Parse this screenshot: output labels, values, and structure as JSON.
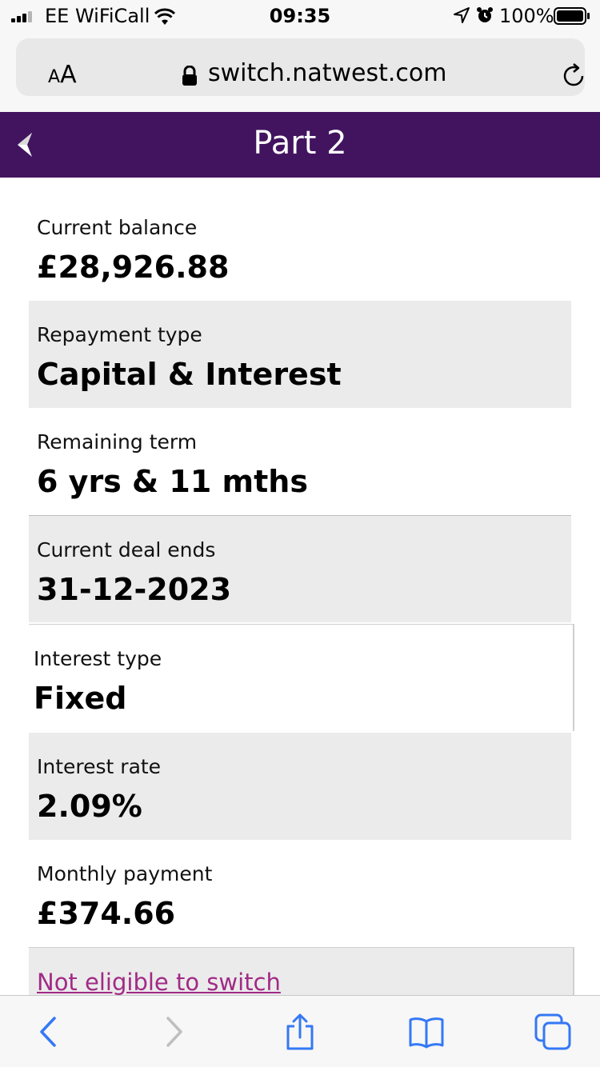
{
  "status_bar": {
    "carrier": "EE WiFiCall",
    "time": "09:35",
    "battery_percent": "100%",
    "icons": [
      "signal-icon",
      "wifi-icon",
      "location-arrow-icon",
      "alarm-icon",
      "battery-icon"
    ]
  },
  "browser": {
    "text_size_label_small": "A",
    "text_size_label_large": "A",
    "url": "switch.natwest.com",
    "icons": [
      "lock-icon",
      "reload-icon"
    ]
  },
  "header": {
    "title": "Part 2",
    "background": "#42145f",
    "icons": [
      "back-chevron-icon"
    ]
  },
  "details": [
    {
      "label": "Current balance",
      "value": "£28,926.88"
    },
    {
      "label": "Repayment type",
      "value": "Capital & Interest"
    },
    {
      "label": "Remaining term",
      "value": "6 yrs & 11 mths"
    },
    {
      "label": "Current deal ends",
      "value": "31-12-2023"
    },
    {
      "label": "Interest type",
      "value": "Fixed"
    },
    {
      "label": "Interest rate",
      "value": "2.09%"
    },
    {
      "label": "Monthly payment",
      "value": "£374.66"
    }
  ],
  "eligibility_link": {
    "label": "Not eligible to switch",
    "color": "#a12a86"
  },
  "toolbar": {
    "icons": [
      "back-arrow-icon",
      "forward-arrow-icon",
      "share-icon",
      "bookmarks-icon",
      "tabs-icon"
    ],
    "accent": "#3478f6"
  }
}
